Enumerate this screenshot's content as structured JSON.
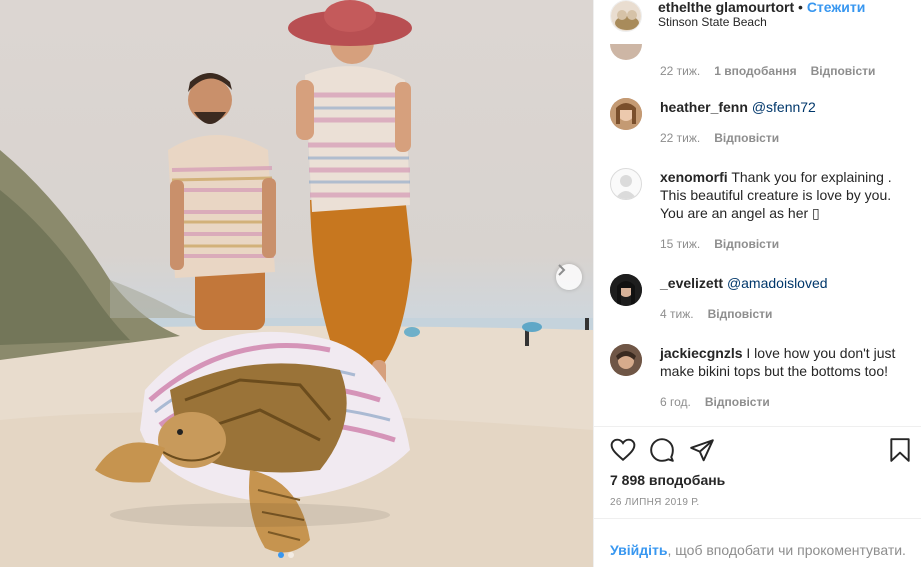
{
  "header": {
    "username": "ethelthe glamourtort",
    "username_exact": "ethelthe glamourtort",
    "separator": " • ",
    "follow_label": "Стежити",
    "location": "Stinson State Beach"
  },
  "comments": [
    {
      "username": "",
      "text": "",
      "time": "22 тиж.",
      "likes": "1 вподобання",
      "reply": "Відповісти"
    },
    {
      "username": "heather_fenn",
      "mention": "@sfenn72",
      "text": "",
      "time": "22 тиж.",
      "reply": "Відповісти"
    },
    {
      "username": "xenomorfi",
      "text": "Thank you for explaining . This beautiful creature is love by you. You are an angel as her ▯",
      "time": "15 тиж.",
      "reply": "Відповісти"
    },
    {
      "username": "_evelizett",
      "mention": "@amadoisloved",
      "text": "",
      "time": "4 тиж.",
      "reply": "Відповісти"
    },
    {
      "username": "jackiecgnzls",
      "text": "I love how you don't just make bikini tops but the bottoms too!",
      "time": "6 год.",
      "reply": "Відповісти"
    }
  ],
  "actions": {
    "icons": [
      "heart-icon",
      "comment-icon",
      "share-icon",
      "bookmark-icon"
    ],
    "likes_count": "7 898 вподобань",
    "date": "26 липня 2019 р."
  },
  "login_prompt": {
    "link": "Увійдіть",
    "text": ", щоб вподобати чи прокоментувати."
  },
  "colors": {
    "accent": "#3897f0",
    "secondary_text": "#8e8e8e",
    "primary_text": "#262626",
    "mention": "#00376b"
  }
}
